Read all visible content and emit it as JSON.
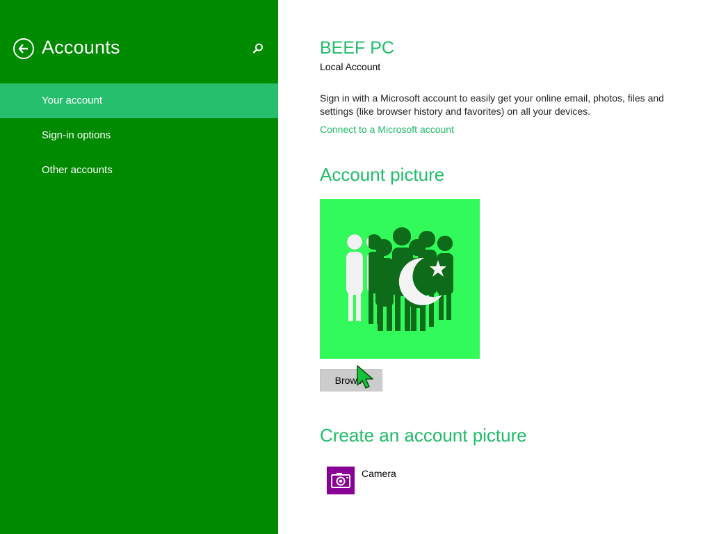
{
  "nav": {
    "title": "Accounts",
    "back_icon": "back-arrow-icon",
    "search_icon": "search-icon",
    "items": [
      {
        "label": "Your account",
        "selected": true
      },
      {
        "label": "Sign-in options",
        "selected": false
      },
      {
        "label": "Other accounts",
        "selected": false
      }
    ]
  },
  "account": {
    "name": "BEEF PC",
    "type": "Local Account",
    "description": "Sign in with a Microsoft account to easily get your online email, photos, files and settings (like browser history and favorites) on all your devices.",
    "connect_link": "Connect to a Microsoft account"
  },
  "account_picture": {
    "heading": "Account picture",
    "browse_label": "Browse"
  },
  "create_picture": {
    "heading": "Create an account picture",
    "apps": [
      {
        "label": "Camera",
        "icon": "camera-icon"
      }
    ]
  },
  "colors": {
    "nav_background": "#008a00",
    "nav_selected": "#26bf6d",
    "accent": "#1ebc68",
    "picture_background": "#32fa5a",
    "camera_tile": "#8a0096"
  }
}
